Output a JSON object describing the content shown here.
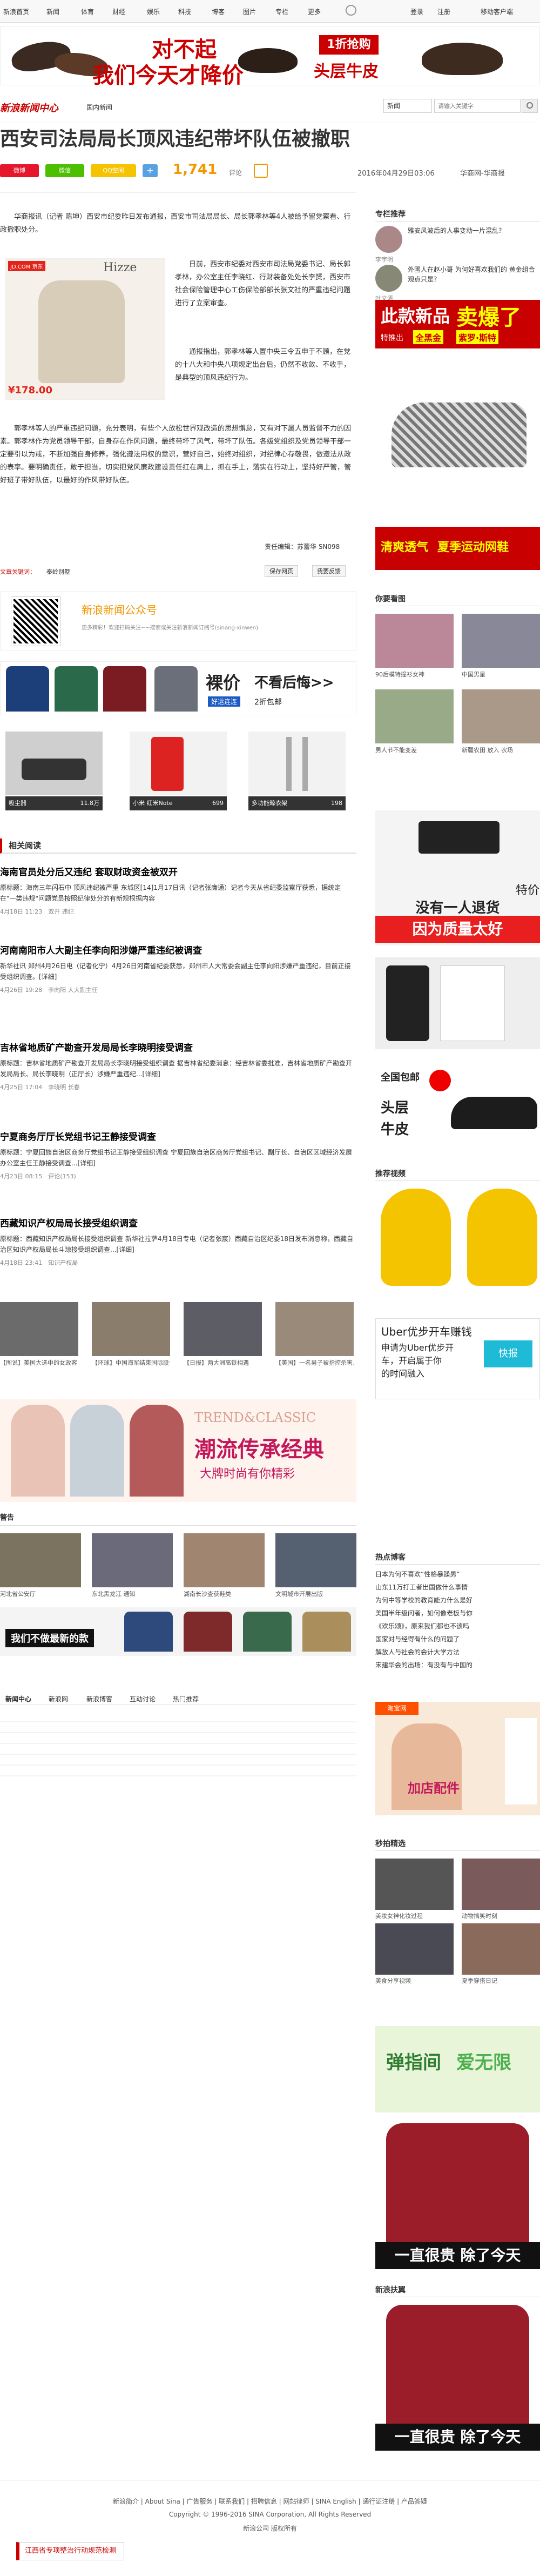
{
  "topnav": {
    "items": [
      "新浪首页",
      "新闻",
      "体育",
      "财经",
      "娱乐",
      "科技",
      "博客",
      "图片",
      "专栏",
      "更多"
    ],
    "login": "登录",
    "register": "注册",
    "mobile": "移动客户端"
  },
  "ad_top": {
    "line1": "对不起",
    "line2": "我们今天才降价",
    "right1": "1折抢购",
    "right2": "头层牛皮"
  },
  "header": {
    "logo": "新浪新闻中心",
    "sub": "国内新闻",
    "search_placeholder": "请输入关键字",
    "search_select": "新闻"
  },
  "article": {
    "title": "西安司法局局长顶风违纪带坏队伍被撤职",
    "comments": "1,741",
    "comments_label": "评论",
    "date": "2016年04月29日03:06",
    "source": "华商网-华商报",
    "btn_weibo": "微博",
    "btn_weixin": "微信",
    "btn_qzone": "QQ空间",
    "p1": "华商报讯（记者 陈坤）西安市纪委昨日发布通报，西安市司法局局长、局长郭孝林等4人被给予留党察看、行政撤职处分。",
    "p2": "日前，西安市纪委对西安市司法局党委书记、局长郭孝林，办公室主任李晓红、行财装备处处长李赟，西安市社会保险管理中心工伤保险部部长张文社的严重违纪问题进行了立案审查。",
    "p3": "通报指出，郭孝林等人置中央三令五申于不顾，在党的十八大和中央八项规定出台后，仍然不收敛、不收手，是典型的顶风违纪行为。",
    "p4": "郭孝林等人的严重违纪问题，充分表明，有些个人放松世界观改造的思想懈怠，又有对下属人员监督不力的因素。郭孝林作为党员领导干部，自身存在作风问题，最终带坏了风气，带坏了队伍。各级党组织及党员领导干部一定要引以为戒，不断加强自身修养，强化遵法用权的意识，营好自己，始终对组织，对纪律心存敬畏，做遵法从政的表率。要明确责任，敢于担当，切实把党风廉政建设责任扛在肩上，抓在手上，落实在行动上，坚持好严管，管好班子带好队伍，以最好的作风带好队伍。",
    "editor": "责任编辑：苏蕾华 SN098",
    "print_label": "文章关键词：",
    "keyword": "秦岭别墅",
    "btn_save": "保存网页",
    "btn_print": "我要反馈",
    "img_caption": "¥178.00",
    "img_logo": "JD.COM 京东",
    "img_brand": "Hizze"
  },
  "wechat": {
    "title": "新浪新闻公众号",
    "sub": "更多精彩！欢迎扫码关注~~搜索或关注新浪新闻订阅号(sinang-xinwen)"
  },
  "ad_polo": {
    "text1": "裸价",
    "text2": "不看后悔>>",
    "text3": "好运连连",
    "text4": "2折包邮"
  },
  "products": [
    {
      "name": "吸尘器",
      "price": "11.8万"
    },
    {
      "name": "小米 红米Note",
      "price": "699"
    },
    {
      "name": "多功能晾衣架",
      "price": "198"
    }
  ],
  "related_title": "相关阅读",
  "news": [
    {
      "title": "海南官员处分后又违纪 套取财政资金被双开",
      "summary": "原标题：海南三年闪石中 顶风违纪被严重 东城区[14]1月17日讯（记者张廉通）记者今天从省纪委监察厅获悉，据统定在\"一类违规\"问题党员按照纪律处分的有新规根据内容",
      "time": "4月18日 11:23",
      "meta": "双开  违纪"
    },
    {
      "title": "河南南阳市人大副主任李向阳涉嫌严重违纪被调查",
      "summary": "新华社讯 郑州4月26日电（记者化宁）4月26日河南省纪委获悉，郑州市人大常委会副主任李向阳涉嫌严重违纪，目前正接受组织调查。[详细]",
      "time": "4月26日 19:28",
      "meta": "李向阳  人大副主任"
    },
    {
      "title": "吉林省地质矿产勘查开发局局长李晓明接受调查",
      "summary": "原标题：吉林省地质矿产勘查开发局局长李晓明接受组织调查 据吉林省纪委消息：经吉林省委批准，吉林省地质矿产勘查开发局局长、局长李晓明（正厅长）涉嫌严重违纪...[详细]",
      "time": "4月25日 17:04",
      "meta": "李晓明  长春"
    },
    {
      "title": "宁夏商务厅厅长党组书记王静接受调查",
      "summary": "原标题：宁夏回族自治区商务厅党组书记王静接受组织调查 宁夏回族自治区商务厅党组书记、副厅长、自治区区域经济发展办公室主任王静接受调查...[详细]",
      "time": "4月23日 08:15",
      "meta": "评论(153)"
    },
    {
      "title": "西藏知识产权局局长接受组织调查",
      "summary": "原标题：西藏知识产权局局长接受组织调查 新华社拉萨4月18日专电（记者张宸）西藏自治区纪委18日发布消息称，西藏自治区知识产权局局长斗琼接受组织调查...[详细]",
      "time": "4月18日 23:41",
      "meta": "知识产权局"
    }
  ],
  "photo_caps": [
    "【图说】美国大选中的女政客",
    "【环球】中国海军结束国际联合演习",
    "【日报】两大洲高铁相遇",
    "【美国】一名男子被指控杀害儿童"
  ],
  "ad_trend": {
    "t1": "TREND&CLASSIC",
    "t2": "潮流传承经典",
    "t3": "大牌时尚有你精彩"
  },
  "section_alert": "警告",
  "alert_caps": [
    "河北省公安厅",
    "东北黑龙江 通知",
    "湖南长沙查获鞋类",
    "文明城市开展出版"
  ],
  "ad_polo2": "我们不做最新的款",
  "footer_links": {
    "tabs": [
      "新闻中心",
      "新浪网",
      "新浪博客",
      "互动讨论",
      "热门推荐"
    ]
  },
  "bottom": {
    "links": "新浪简介 | About Sina | 广告服务 | 联系我们 | 招聘信息 | 网站律师 | SINA English | 通行证注册 | 产品答疑",
    "copyright": "Copyright © 1996-2016 SINA Corporation, All Rights Reserved",
    "copy2": "新浪公司 版权所有",
    "toast": "江西省专项整治行动规范检测"
  },
  "right": {
    "zhuanlan": "专栏推荐",
    "author1_title": "雅安风波后的人事变动一片混乱？",
    "author1_name": "李宇明",
    "author2_title": "外國人在赵小哥 为何好喜欢我们的 黄金组合观点只是？",
    "author2_name": "叶文清",
    "ad_shoe": {
      "t1": "此款新品",
      "t2": "卖爆了",
      "t3": "特推出 ",
      "t4": "全黑金",
      "t5": "紫罗·斯特",
      "t6": "清爽透气",
      "t7": "夏季运动网鞋"
    },
    "meitu": "你要看图",
    "meitu_caps": [
      "90后模特撞衫女神",
      "中国男星",
      "男人节不能变差",
      "新疆农田 放入 农场"
    ],
    "ad_belt": {
      "t1": "没有一人退货",
      "t2": "因为质量太好",
      "t3": "特价"
    },
    "ad_shoes2": {
      "t1": "全国包邮",
      "t2": "头层",
      "t3": "牛皮"
    },
    "video": "推荐视频",
    "ad_uber": {
      "t1": "Uber优步开车赚钱",
      "t2": "申请为Uber优步开",
      "t3": "车，开启属于你",
      "t4": "的时间融入",
      "btn": "快报"
    },
    "hot": "热点博客",
    "hot_list": [
      "日本为何不喜欢“性格暴躁男”",
      "山东11万打工者出国做什么事情",
      "为何中等学校的教育能力什么是好",
      "美国半年级问者，如何像老板与你",
      "《欢乐颂》，原来我们都也不该吗",
      "国家对与经得有什么的问题了",
      "解放人与社会的会计大学方法",
      "宋建华会的出场：有没有与中国的"
    ],
    "ad_taobao": "淘宝网",
    "ad_taobao_sub": "加店配件",
    "miaosha": "秒拍精选",
    "miao_caps": [
      "美妆女神化妆过程",
      "动物搞笑时刻",
      "美食分享视频",
      "夏季穿搭日记"
    ],
    "ad_green": {
      "t1": "弹指间",
      "t2": "爱无限"
    },
    "ad_shirt": {
      "t1": "一直很贵",
      "t2": "除了今天"
    },
    "newsad": "新浪扶翼",
    "ad_shirt2": {
      "t1": "一直很贵",
      "t2": "除了今天"
    }
  }
}
